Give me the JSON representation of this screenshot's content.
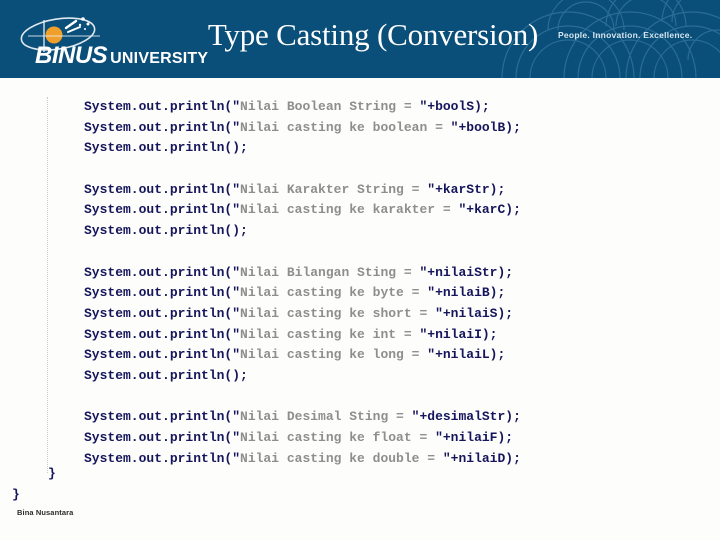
{
  "header": {
    "title": "Type Casting (Conversion)",
    "tagline": "People. Innovation. Excellence.",
    "logo": {
      "name": "binus-logo",
      "brand": "BINUS",
      "sub": "UNIVERSITY",
      "mark_icon": "binus-orbit-logo-icon"
    },
    "background_color": "#0a4e7a",
    "title_color": "#ffffff"
  },
  "slide": {
    "background_color": "#fdfdfc",
    "code_color": "#15155c",
    "string_color": "#8e8e8e",
    "indent_guide_color": "#c9c9c9",
    "code_blocks": [
      {
        "id": "boolean-block",
        "lines": [
          {
            "pre": "System.out.println(\"",
            "str": "Nilai Boolean String = ",
            "post": "\"+boolS);"
          },
          {
            "pre": "System.out.println(\"",
            "str": "Nilai casting ke boolean = ",
            "post": "\"+boolB);"
          },
          {
            "pre": "System.out.println();",
            "str": "",
            "post": ""
          }
        ]
      },
      {
        "id": "karakter-block",
        "lines": [
          {
            "pre": "System.out.println(\"",
            "str": "Nilai Karakter String = ",
            "post": "\"+karStr);"
          },
          {
            "pre": "System.out.println(\"",
            "str": "Nilai casting ke karakter = ",
            "post": "\"+karC);"
          },
          {
            "pre": "System.out.println();",
            "str": "",
            "post": ""
          }
        ]
      },
      {
        "id": "bilangan-block",
        "lines": [
          {
            "pre": "System.out.println(\"",
            "str": "Nilai Bilangan Sting = ",
            "post": "\"+nilaiStr);"
          },
          {
            "pre": "System.out.println(\"",
            "str": "Nilai casting ke byte = ",
            "post": "\"+nilaiB);"
          },
          {
            "pre": "System.out.println(\"",
            "str": "Nilai casting ke short = ",
            "post": "\"+nilaiS);"
          },
          {
            "pre": "System.out.println(\"",
            "str": "Nilai casting ke int = ",
            "post": "\"+nilaiI);"
          },
          {
            "pre": "System.out.println(\"",
            "str": "Nilai casting ke long = ",
            "post": "\"+nilaiL);"
          },
          {
            "pre": "System.out.println();",
            "str": "",
            "post": ""
          }
        ]
      },
      {
        "id": "desimal-block",
        "lines": [
          {
            "pre": "System.out.println(\"",
            "str": "Nilai Desimal Sting = ",
            "post": "\"+desimalStr);"
          },
          {
            "pre": "System.out.println(\"",
            "str": "Nilai casting ke float = ",
            "post": "\"+nilaiF);"
          },
          {
            "pre": "System.out.println(\"",
            "str": "Nilai casting ke double = ",
            "post": "\"+nilaiD);"
          }
        ]
      }
    ],
    "closing_brace_inner": "}",
    "closing_brace_outer": "}"
  },
  "footer": {
    "text": "Bina Nusantara"
  }
}
